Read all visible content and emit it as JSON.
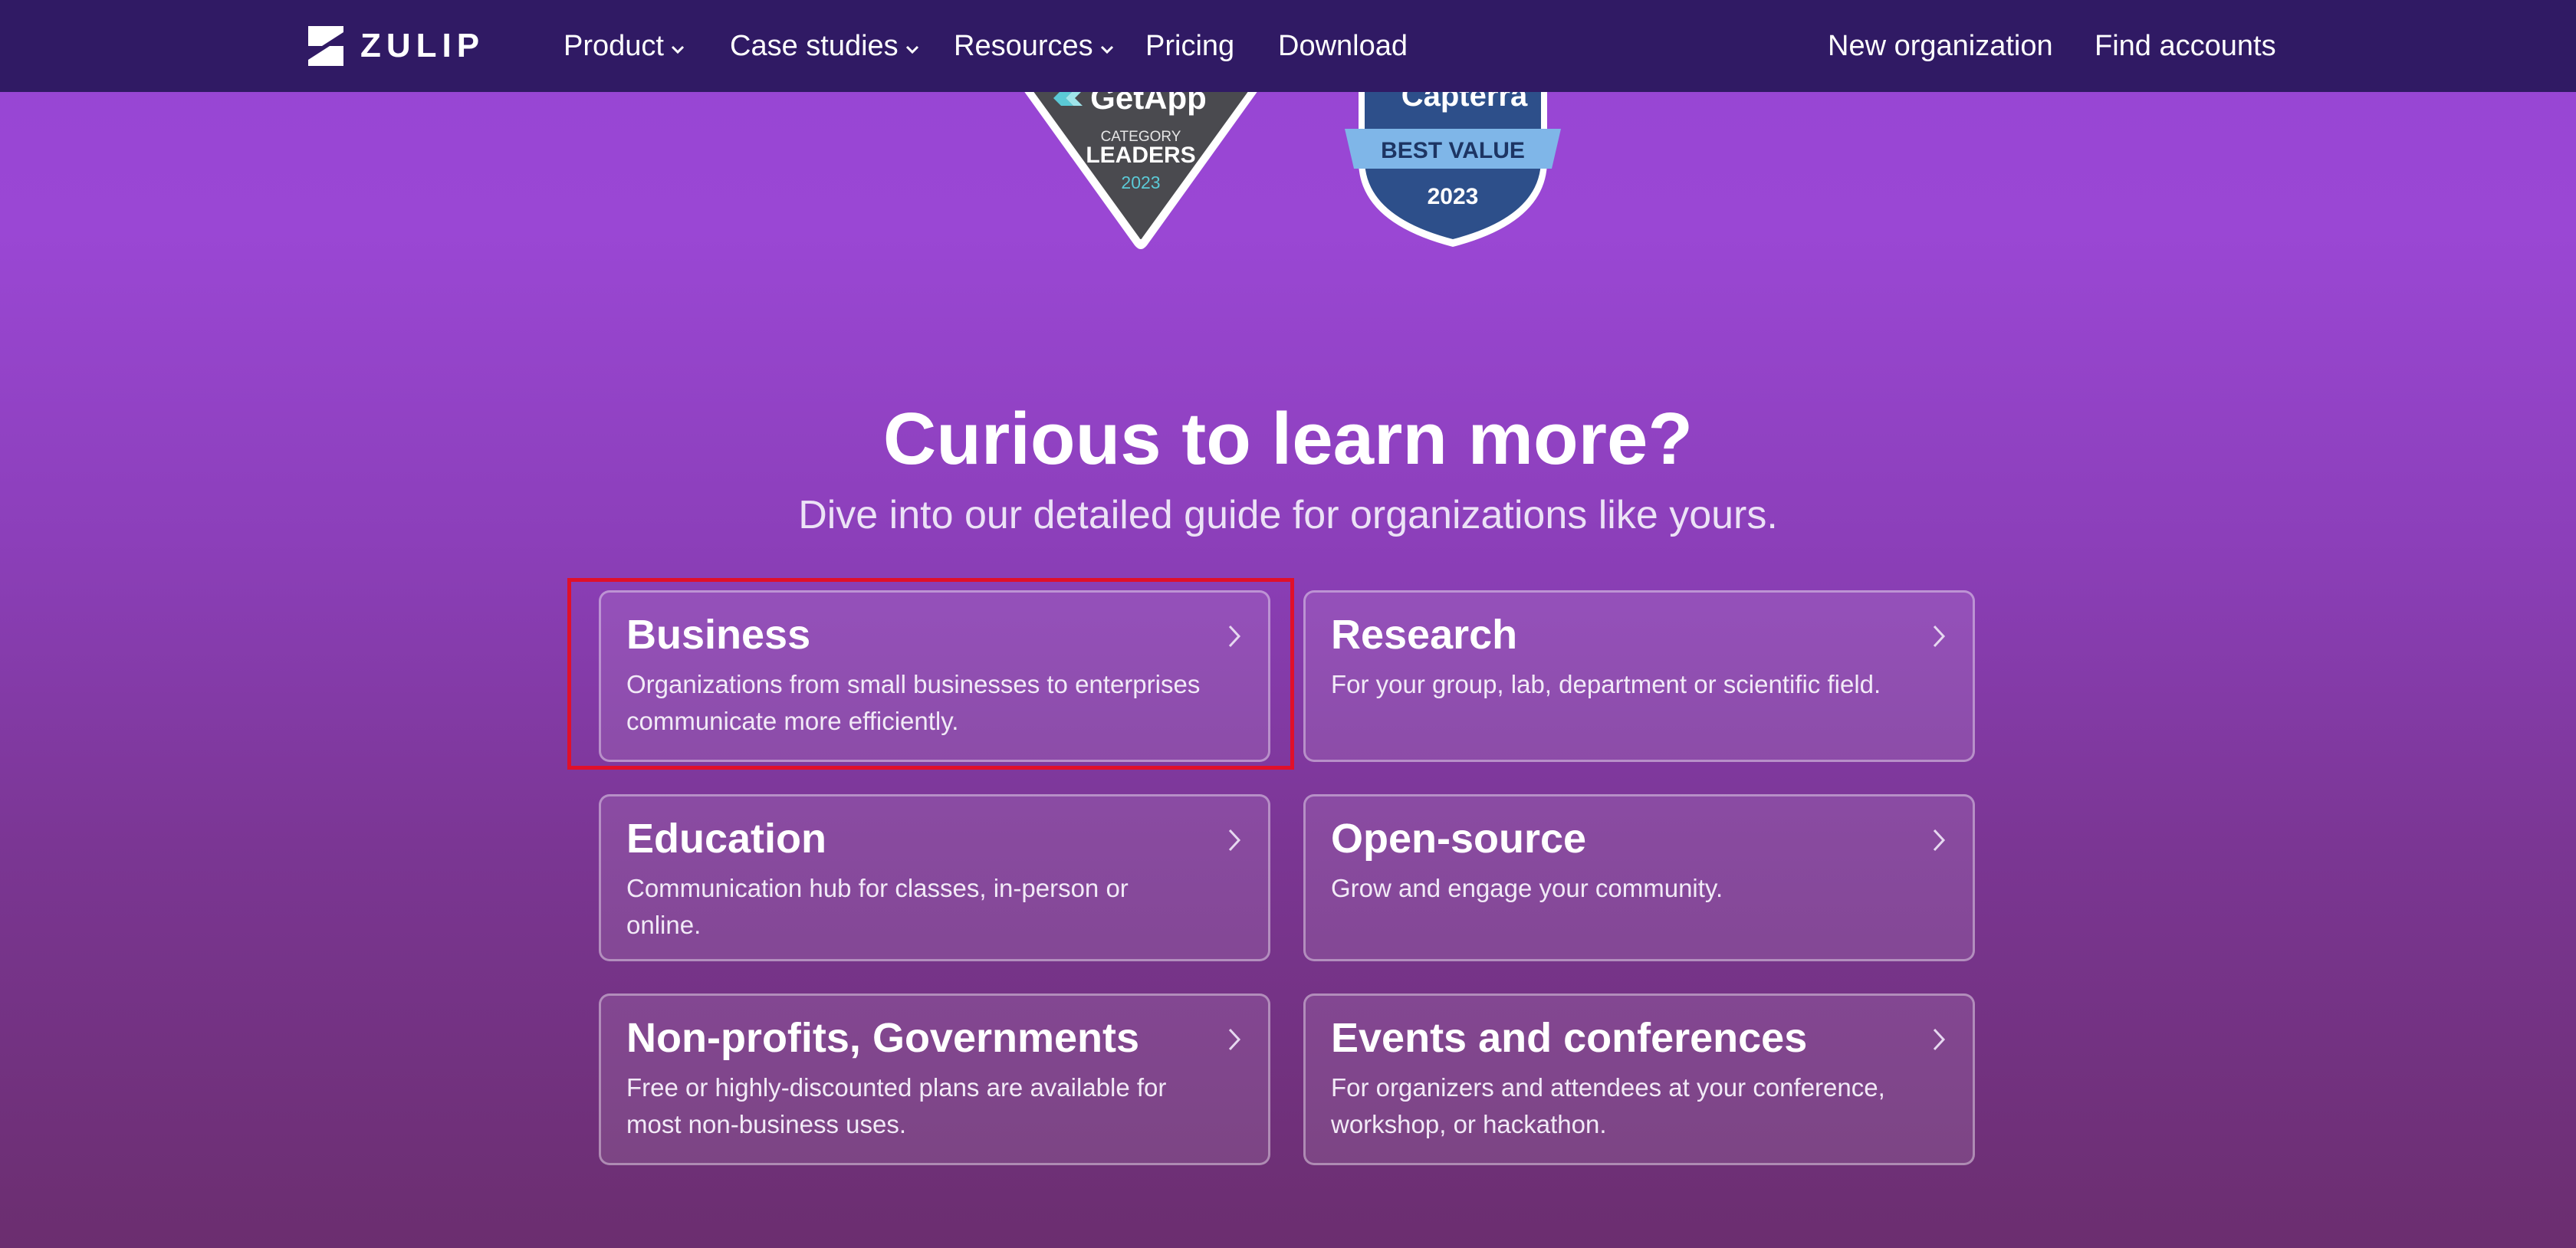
{
  "navbar": {
    "logo_text": "ZULIP",
    "items": [
      {
        "label": "Product",
        "has_dropdown": true
      },
      {
        "label": "Case studies",
        "has_dropdown": true
      },
      {
        "label": "Resources",
        "has_dropdown": true
      },
      {
        "label": "Pricing",
        "has_dropdown": false
      },
      {
        "label": "Download",
        "has_dropdown": false
      }
    ],
    "right_items": [
      {
        "label": "New organization"
      },
      {
        "label": "Find accounts"
      }
    ]
  },
  "badges": {
    "getapp": {
      "brand": "GetApp",
      "line1": "CATEGORY",
      "line2": "LEADERS",
      "year": "2023"
    },
    "capterra": {
      "brand": "Capterra",
      "ribbon": "BEST VALUE",
      "year": "2023"
    }
  },
  "section": {
    "heading": "Curious to learn more?",
    "subheading": "Dive into our detailed guide for organizations like yours."
  },
  "cards": [
    {
      "title": "Business",
      "description": "Organizations from small businesses to enterprises communicate more efficiently."
    },
    {
      "title": "Research",
      "description": "For your group, lab, department or scientific field."
    },
    {
      "title": "Education",
      "description": "Communication hub for classes, in-person or online."
    },
    {
      "title": "Open-source",
      "description": "Grow and engage your community."
    },
    {
      "title": "Non-profits, Governments",
      "description": "Free or highly-discounted plans are available for most non-business uses."
    },
    {
      "title": "Events and conferences",
      "description": "For organizers and attendees at your conference, workshop, or hackathon."
    }
  ],
  "colors": {
    "navbar_bg": "#301a64",
    "highlight_border": "#e0102a",
    "getapp_badge": "#4a4a4f",
    "capterra_badge": "#2d4f8a",
    "capterra_ribbon": "#7fb6e8"
  }
}
